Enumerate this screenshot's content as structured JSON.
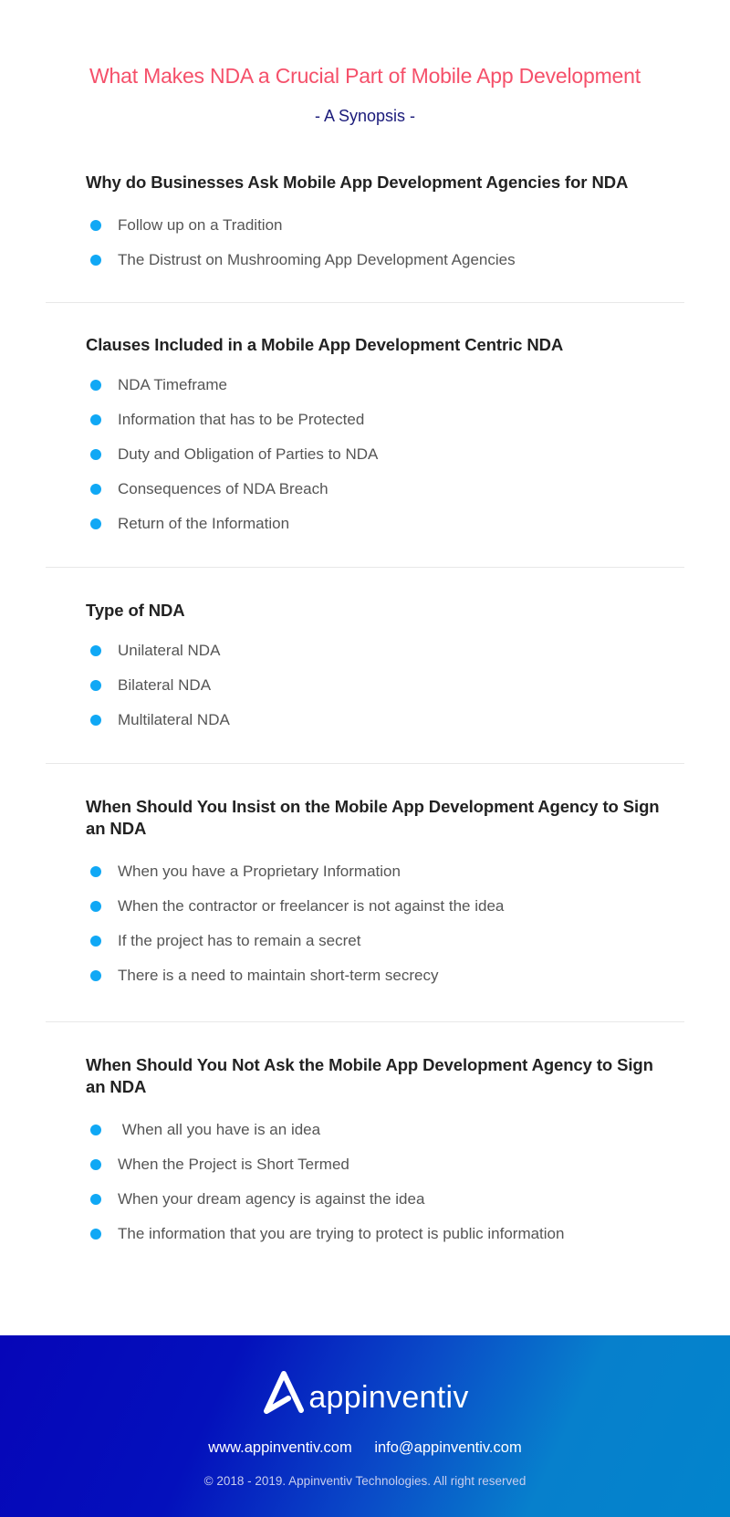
{
  "header": {
    "title": "What Makes NDA a Crucial Part of Mobile App Development",
    "subtitle": "- A Synopsis -"
  },
  "sections": [
    {
      "title": "Why do Businesses Ask Mobile App Development Agencies for NDA",
      "items": [
        "Follow up on a Tradition",
        "The Distrust on Mushrooming App Development Agencies"
      ]
    },
    {
      "title": "Clauses Included in a Mobile App Development Centric NDA",
      "items": [
        "NDA Timeframe",
        "Information that has to be Protected",
        "Duty and Obligation of Parties to NDA",
        "Consequences of NDA Breach",
        "Return of the Information"
      ]
    },
    {
      "title": "Type of NDA",
      "items": [
        "Unilateral NDA",
        "Bilateral NDA",
        "Multilateral NDA"
      ]
    },
    {
      "title": "When Should You Insist on the Mobile App Development Agency to Sign an NDA",
      "items": [
        "When you have a Proprietary Information",
        "When the contractor or freelancer is not against the idea",
        "If the project has to remain a secret",
        "There is a need to maintain short-term secrecy"
      ]
    },
    {
      "title": "When Should You Not Ask the Mobile App Development Agency to Sign an NDA",
      "items": [
        " When all you have is an idea",
        "When the Project is Short Termed",
        "When your dream agency is against the idea",
        "The information that you are trying to protect is public information"
      ]
    }
  ],
  "footer": {
    "logo_text": "appinventiv",
    "logo_icon": "appinventiv-a-logo-icon",
    "website": "www.appinventiv.com",
    "email": "info@appinventiv.com",
    "copyright": "© 2018 - 2019. Appinventiv Technologies. All right reserved"
  },
  "colors": {
    "title": "#f5506a",
    "subtitle": "#1a1a7a",
    "bullet": "#10a8f5",
    "footer_gradient_start": "#0606b8",
    "footer_gradient_end": "#0284cc"
  }
}
